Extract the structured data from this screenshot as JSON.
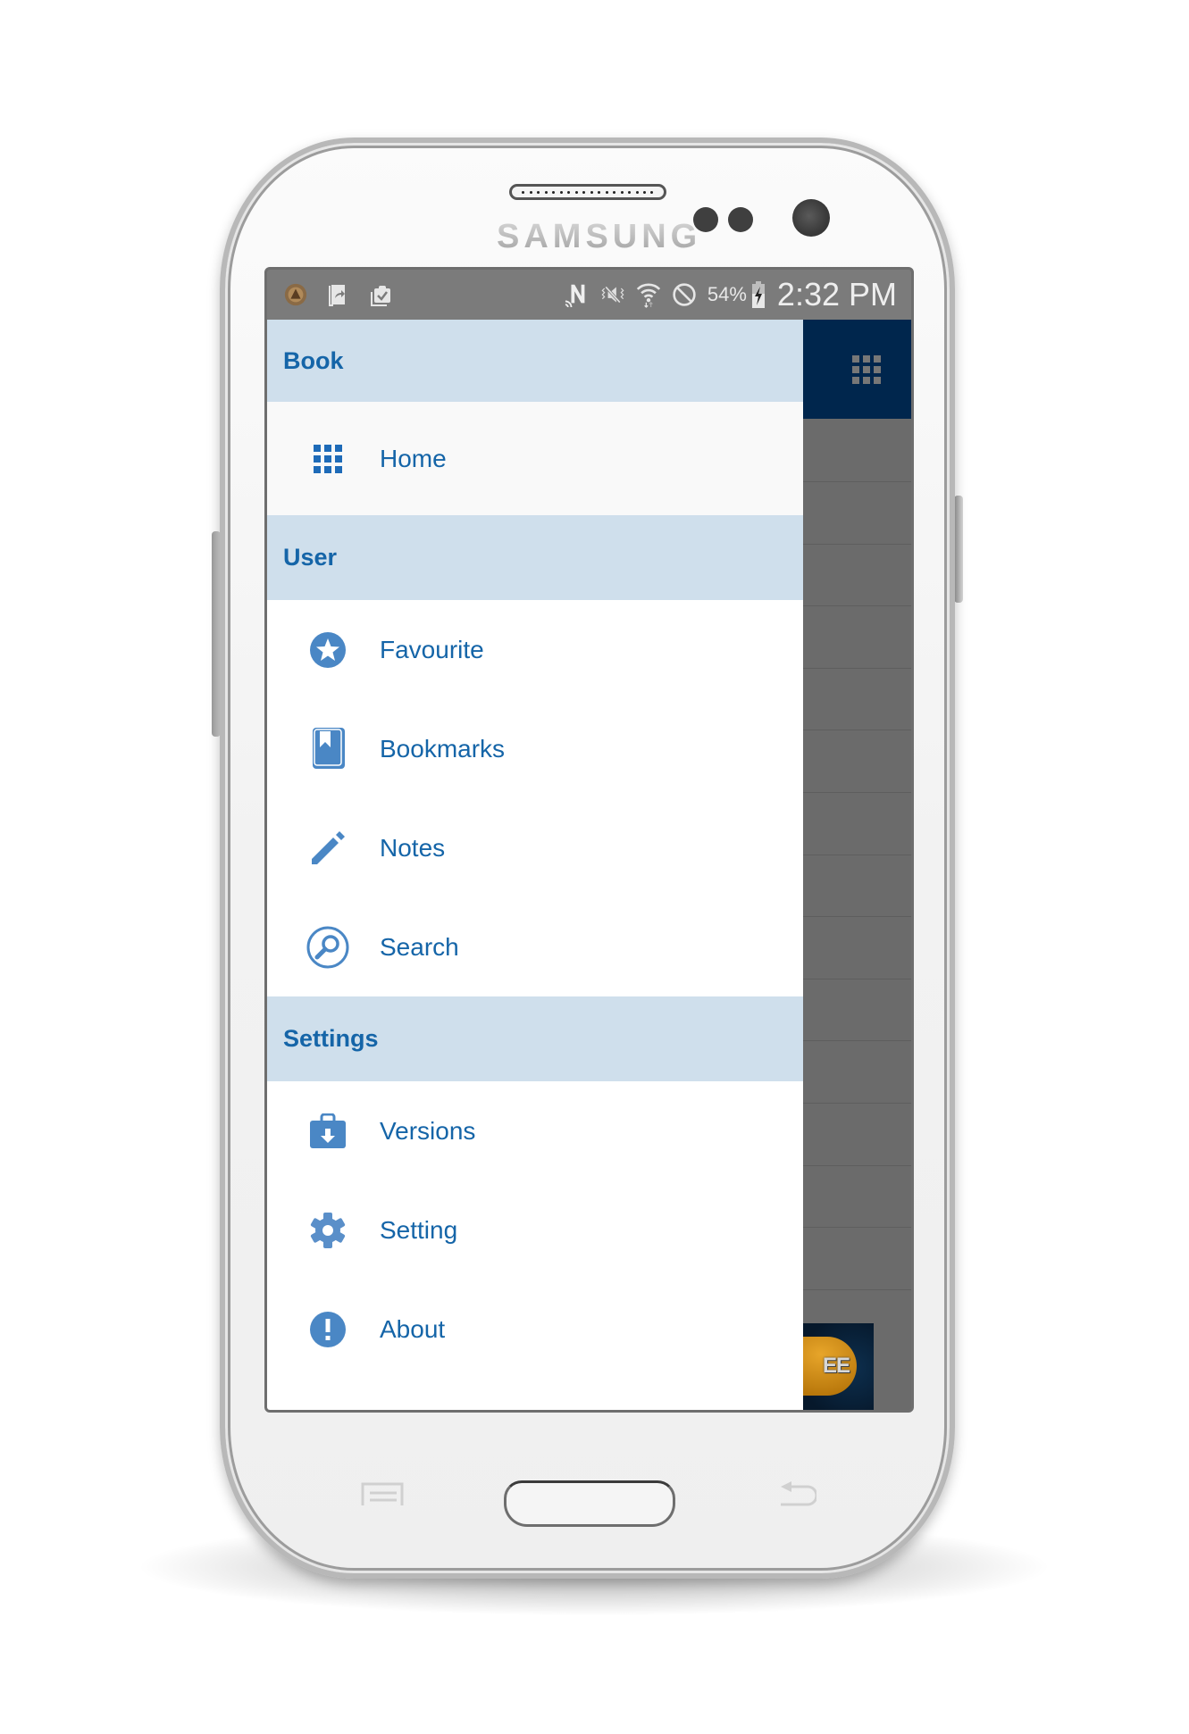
{
  "device": {
    "brand": "SAMSUNG",
    "keys": {
      "menu": "menu-key",
      "home": "home-key",
      "back": "back-key"
    }
  },
  "status_bar": {
    "left_icons": [
      "app-notification-icon",
      "screen-share-icon",
      "clipboard-check-icon"
    ],
    "right_icons": [
      "nfc-icon",
      "vibrate-mute-icon",
      "wifi-icon",
      "do-not-disturb-icon"
    ],
    "battery_percent": "54%",
    "battery_charging": true,
    "time": "2:32 PM"
  },
  "colors": {
    "accent": "#1565a8",
    "icon": "#4a87c5",
    "section_header_bg": "#cfdfec",
    "app_bar": "#00264d",
    "scrim": "#6b6b6b"
  },
  "drawer": {
    "sections": [
      {
        "title": "Book",
        "items": [
          {
            "label": "Home",
            "icon": "grid-icon"
          }
        ]
      },
      {
        "title": "User",
        "items": [
          {
            "label": "Favourite",
            "icon": "star-circle-icon"
          },
          {
            "label": "Bookmarks",
            "icon": "bookmark-book-icon"
          },
          {
            "label": "Notes",
            "icon": "pencil-icon"
          },
          {
            "label": "Search",
            "icon": "search-circle-icon"
          }
        ]
      },
      {
        "title": "Settings",
        "items": [
          {
            "label": "Versions",
            "icon": "briefcase-download-icon"
          },
          {
            "label": "Setting",
            "icon": "gear-icon"
          },
          {
            "label": "About",
            "icon": "info-exclamation-icon"
          }
        ]
      }
    ]
  },
  "background_app": {
    "app_bar_icon": "grid-menu-icon",
    "ad_banner_text": "EE"
  }
}
